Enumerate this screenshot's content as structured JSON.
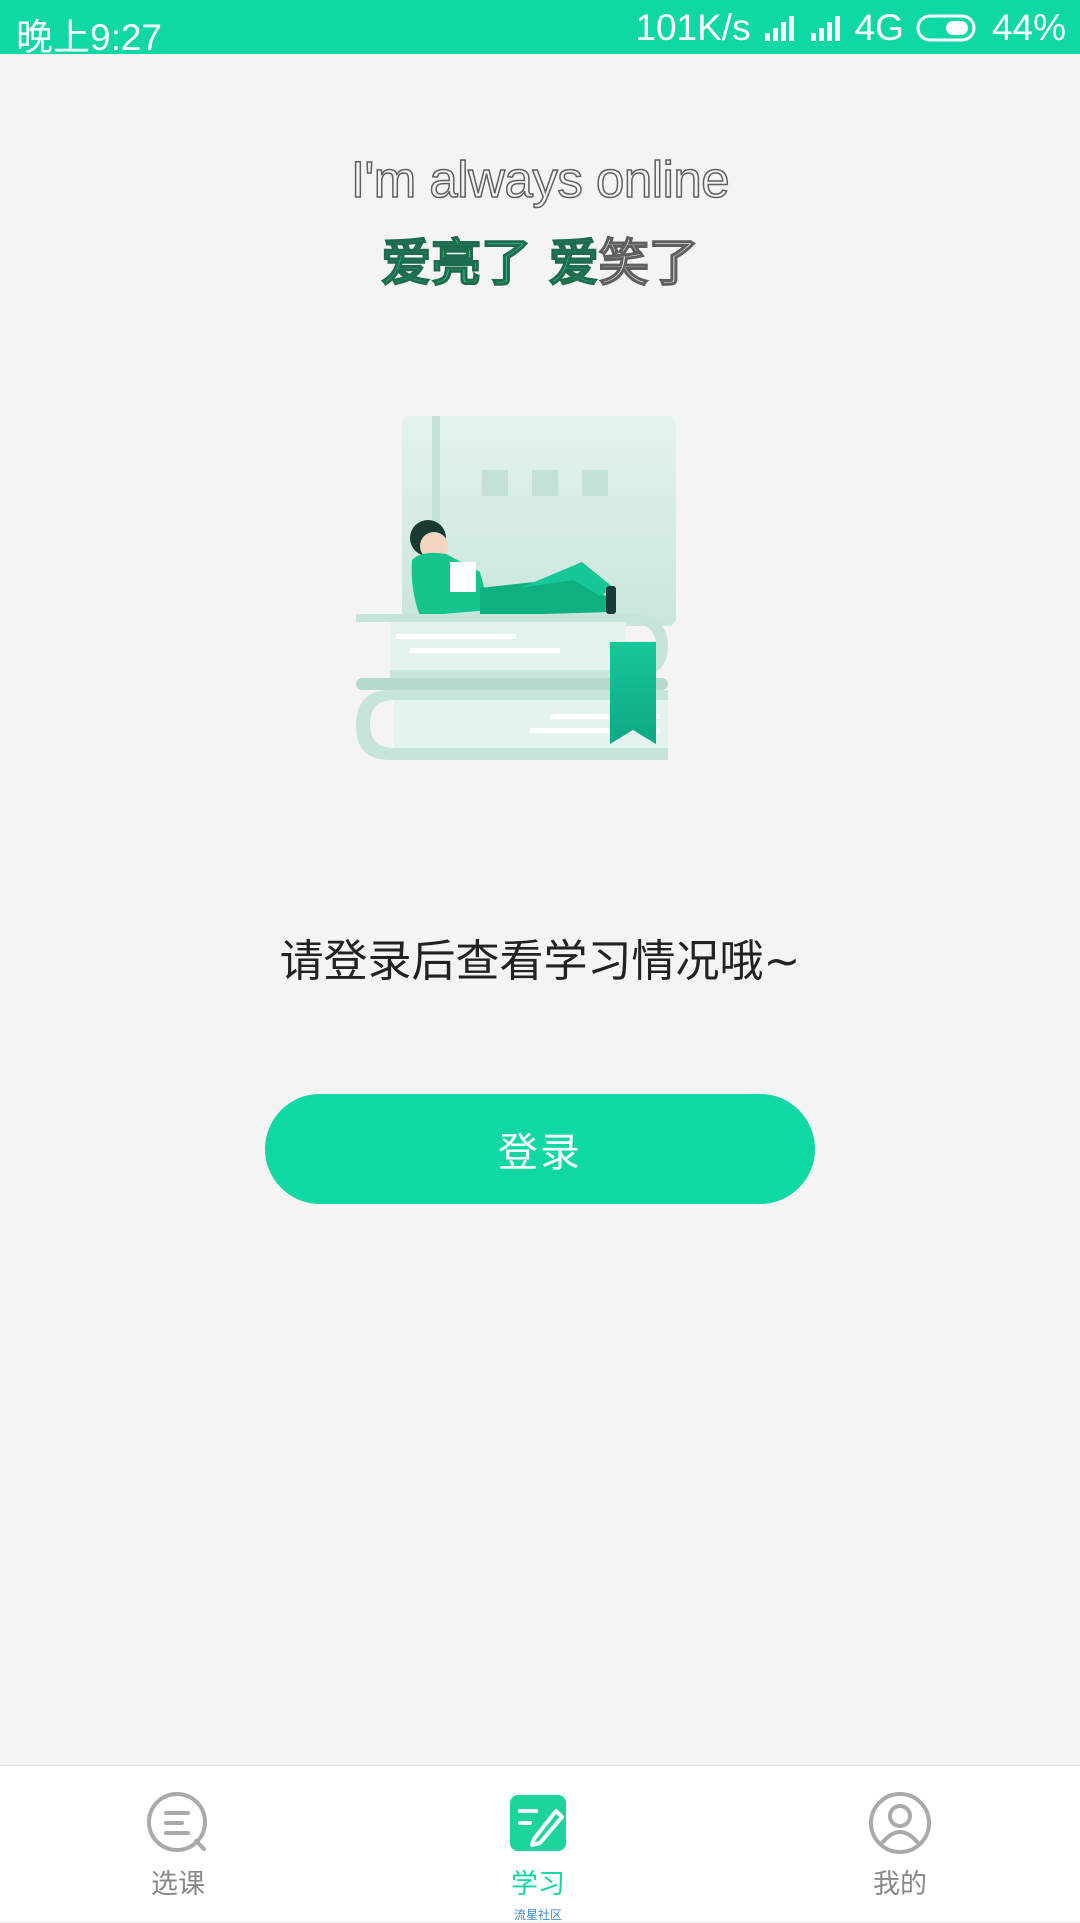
{
  "status_bar": {
    "time": "晚上9:27",
    "speed": "101K/s",
    "network": "4G",
    "battery": "44%"
  },
  "headline": {
    "english": "I'm always online",
    "chinese_green": "爱亮了 爱",
    "chinese_outline": "笑了"
  },
  "message": "请登录后查看学习情况哦~",
  "login_button": "登录",
  "colors": {
    "accent": "#10d8a4",
    "background": "#f4f4f4"
  },
  "tabs": [
    {
      "label": "选课",
      "icon": "chat-list-icon",
      "active": false
    },
    {
      "label": "学习",
      "icon": "edit-note-icon",
      "active": true,
      "sub_label": "流星社区"
    },
    {
      "label": "我的",
      "icon": "user-icon",
      "active": false
    }
  ]
}
